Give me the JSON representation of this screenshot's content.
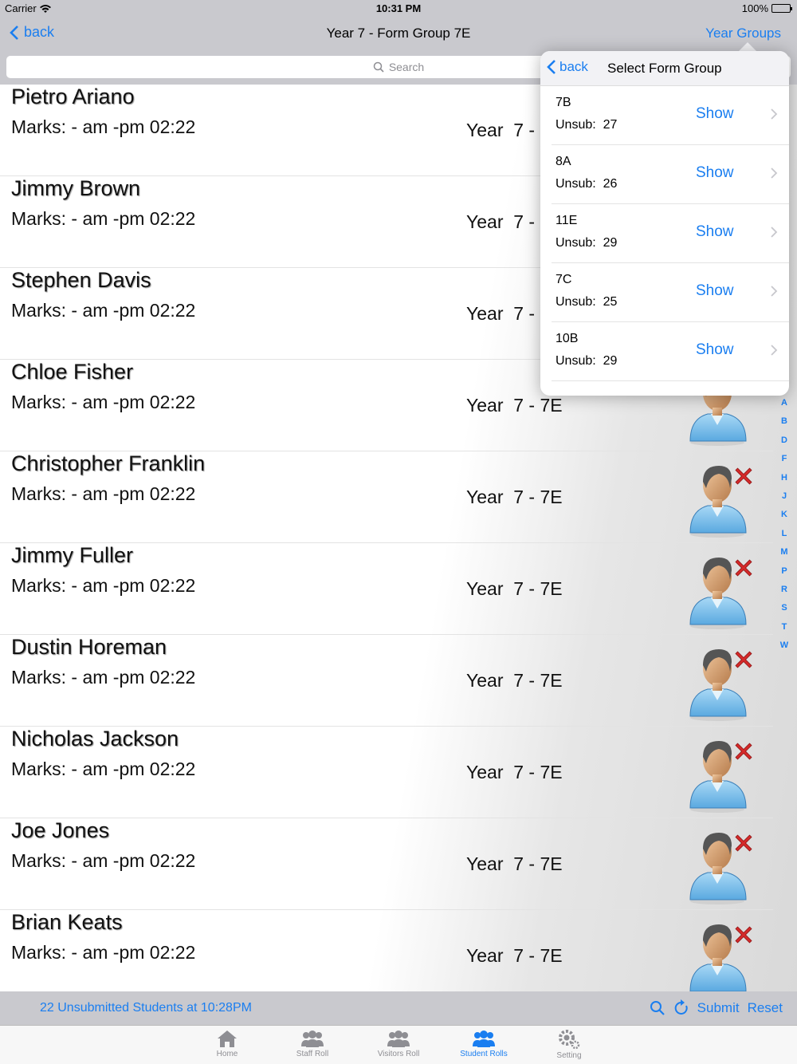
{
  "status_bar": {
    "carrier": "Carrier",
    "time": "10:31 PM",
    "battery": "100%"
  },
  "nav": {
    "back_label": "back",
    "title": "Year  7 - Form Group 7E",
    "right_label": "Year Groups"
  },
  "search": {
    "placeholder": "Search"
  },
  "students": [
    {
      "name": "Pietro Ariano",
      "marks": "Marks: - am -pm 02:22",
      "year": "Year  7 - 7E"
    },
    {
      "name": "Jimmy Brown",
      "marks": "Marks: - am -pm 02:22",
      "year": "Year  7 - 7E"
    },
    {
      "name": "Stephen Davis",
      "marks": "Marks: - am -pm 02:22",
      "year": "Year  7 - 7E"
    },
    {
      "name": "Chloe Fisher",
      "marks": "Marks: - am -pm 02:22",
      "year": "Year  7 - 7E"
    },
    {
      "name": "Christopher Franklin",
      "marks": "Marks: - am -pm 02:22",
      "year": "Year  7 - 7E"
    },
    {
      "name": "Jimmy Fuller",
      "marks": "Marks: - am -pm 02:22",
      "year": "Year  7 - 7E"
    },
    {
      "name": "Dustin Horeman",
      "marks": "Marks: - am -pm 02:22",
      "year": "Year  7 - 7E"
    },
    {
      "name": "Nicholas Jackson",
      "marks": "Marks: - am -pm 02:22",
      "year": "Year  7 - 7E"
    },
    {
      "name": "Joe Jones",
      "marks": "Marks: - am -pm 02:22",
      "year": "Year  7 - 7E"
    },
    {
      "name": "Brian Keats",
      "marks": "Marks: - am -pm 02:22",
      "year": "Year  7 - 7E"
    }
  ],
  "index_letters": [
    "A",
    "B",
    "D",
    "F",
    "H",
    "J",
    "K",
    "L",
    "M",
    "P",
    "R",
    "S",
    "T",
    "W"
  ],
  "popover": {
    "back_label": "back",
    "title": "Select Form Group",
    "groups": [
      {
        "code": "7B",
        "unsub": "Unsub:  27",
        "action": "Show"
      },
      {
        "code": "8A",
        "unsub": "Unsub:  26",
        "action": "Show"
      },
      {
        "code": "11E",
        "unsub": "Unsub:  29",
        "action": "Show"
      },
      {
        "code": "7C",
        "unsub": "Unsub:  25",
        "action": "Show"
      },
      {
        "code": "10B",
        "unsub": "Unsub:  29",
        "action": "Show"
      }
    ]
  },
  "toolbar": {
    "status": "22 Unsubmitted Students at 10:28PM",
    "submit_label": "Submit",
    "reset_label": "Reset"
  },
  "tabs": [
    {
      "label": "Home",
      "icon": "home-icon"
    },
    {
      "label": "Staff Roll",
      "icon": "staff-icon"
    },
    {
      "label": "Visitors Roll",
      "icon": "visitors-icon"
    },
    {
      "label": "Student Rolls",
      "icon": "students-icon"
    },
    {
      "label": "Setting",
      "icon": "gear-icon"
    }
  ],
  "colors": {
    "accent": "#1a7ef0",
    "bar": "#c9c9ce",
    "absent_mark": "#d42a2a"
  }
}
